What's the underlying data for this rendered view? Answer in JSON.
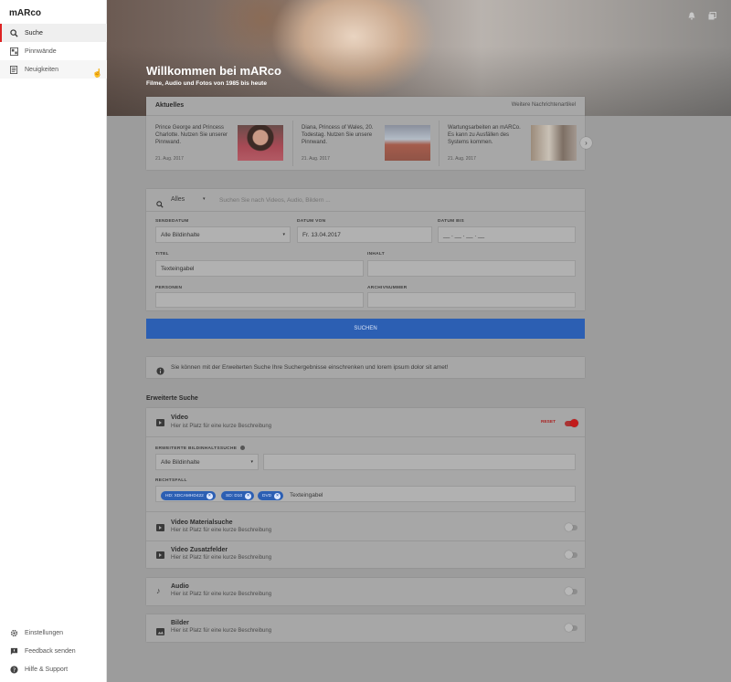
{
  "app": {
    "brand": "mARco"
  },
  "sidebar": {
    "items": [
      {
        "label": "Suche",
        "icon": "search-icon"
      },
      {
        "label": "Pinnwände",
        "icon": "pinboard-icon"
      },
      {
        "label": "Neuigkeiten",
        "icon": "news-icon"
      }
    ],
    "bottom": [
      {
        "label": "Einstellungen",
        "icon": "gear-icon"
      },
      {
        "label": "Feedback senden",
        "icon": "feedback-icon"
      },
      {
        "label": "Hilfe & Support",
        "icon": "help-icon"
      }
    ]
  },
  "hero": {
    "title": "Willkommen bei mARco",
    "subtitle": "Filme, Audio und Fotos von 1985 bis heute"
  },
  "news": {
    "header": "Aktuelles",
    "more_link": "Weitere Nachrichtenartikel",
    "items": [
      {
        "text": "Prince George and Princess Charlotte. Nutzen Sie unserer Pinnwand.",
        "date": "21. Aug. 2017"
      },
      {
        "text": "Diana, Princess of Wales, 20. Todestag. Nutzen Sie unsere Pinnwand.",
        "date": "21. Aug. 2017"
      },
      {
        "text": "Wartungsarbeiten an mARCo. Es kann zu Ausfällen des Systems kommen.",
        "date": "21. Aug. 2017"
      }
    ]
  },
  "search": {
    "scope": "Alles",
    "placeholder": "Suchen Sie nach Videos, Audio, Bildern ...",
    "fields": {
      "sendedatum_label": "SENDEDATUM",
      "sendedatum_value": "Alle Bildinhalte",
      "datum_von_label": "DATUM VON",
      "datum_von_value": "Fr. 13.04.2017",
      "datum_bis_label": "DATUM BIS",
      "datum_bis_value": "__ . __ . __ . __",
      "titel_label": "TITEL",
      "titel_value": "Texteingabel",
      "inhalt_label": "INHALT",
      "personen_label": "PERSONEN",
      "archivnummer_label": "ARCHIVNUMMER"
    },
    "submit": "SUCHEN"
  },
  "info": {
    "text": "Sie können mit der Erweiterten Suche Ihre Suchergebnisse einschrenken und lorem ipsum dolor sit amet!"
  },
  "advanced": {
    "title": "Erweiterte Suche",
    "video": {
      "title": "Video",
      "desc": "Hier ist Platz für eine kurze Beschreibung",
      "reset": "RESET",
      "bildinhalt_label": "ERWEITERTE BILDINHALTSSUCHE",
      "bildinhalt_value": "Alle Bildinhalte",
      "rechtsfall_label": "RECHTSFALL",
      "chips": [
        "HD: XDCAMHD422",
        "SD: D10",
        "DVD"
      ],
      "chip_input": "Texteingabel"
    },
    "sections": [
      {
        "title": "Video Materialsuche",
        "desc": "Hier ist Platz für eine kurze Beschreibung"
      },
      {
        "title": "Video Zusatzfelder",
        "desc": "Hier ist Platz für eine kurze Beschreibung"
      },
      {
        "title": "Audio",
        "desc": "Hier ist Platz für eine kurze Beschreibung"
      },
      {
        "title": "Bilder",
        "desc": "Hier ist Platz für eine kurze Beschreibung"
      }
    ]
  },
  "colors": {
    "accent": "#d22222",
    "primary_button": "#2c5fb3",
    "overlay": "#9c9c9c"
  }
}
